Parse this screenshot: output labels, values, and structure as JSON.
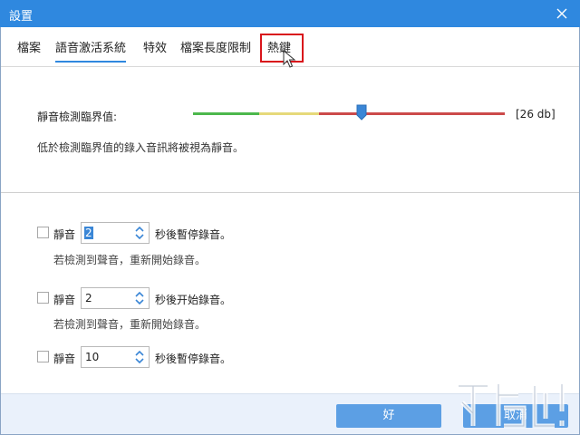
{
  "window": {
    "title": "設置"
  },
  "tabs": [
    {
      "label": "檔案",
      "active": false
    },
    {
      "label": "語音激活系統",
      "active": true
    },
    {
      "label": "特效",
      "active": false
    },
    {
      "label": "檔案長度限制",
      "active": false
    },
    {
      "label": "熱鍵",
      "active": false,
      "highlighted": true
    }
  ],
  "threshold": {
    "label": "靜音檢測臨界值:",
    "value_text": "[26 db]",
    "slider_position": 0.54,
    "description": "低於檢測臨界值的錄入音訊將被視為靜音。"
  },
  "rules": [
    {
      "checkbox_label": "靜音",
      "checked": false,
      "value": "2",
      "selected": true,
      "after_text": "秒後暫停錄音。",
      "note": "若檢測到聲音，重新開始錄音。"
    },
    {
      "checkbox_label": "靜音",
      "checked": false,
      "value": "2",
      "selected": false,
      "after_text": "秒後开始錄音。",
      "note": "若檢測到聲音，重新開始錄音。"
    },
    {
      "checkbox_label": "靜音",
      "checked": false,
      "value": "10",
      "selected": false,
      "after_text": "秒後暫停錄音。",
      "note": ""
    }
  ],
  "buttons": {
    "ok": "好",
    "cancel": "取消"
  },
  "colors": {
    "titlebar": "#2f88df",
    "accent": "#2f88df",
    "slider_green": "#4cb84c",
    "slider_yellow": "#e6d97a",
    "slider_red": "#cc4a4a",
    "highlight_box": "#d9151b"
  }
}
